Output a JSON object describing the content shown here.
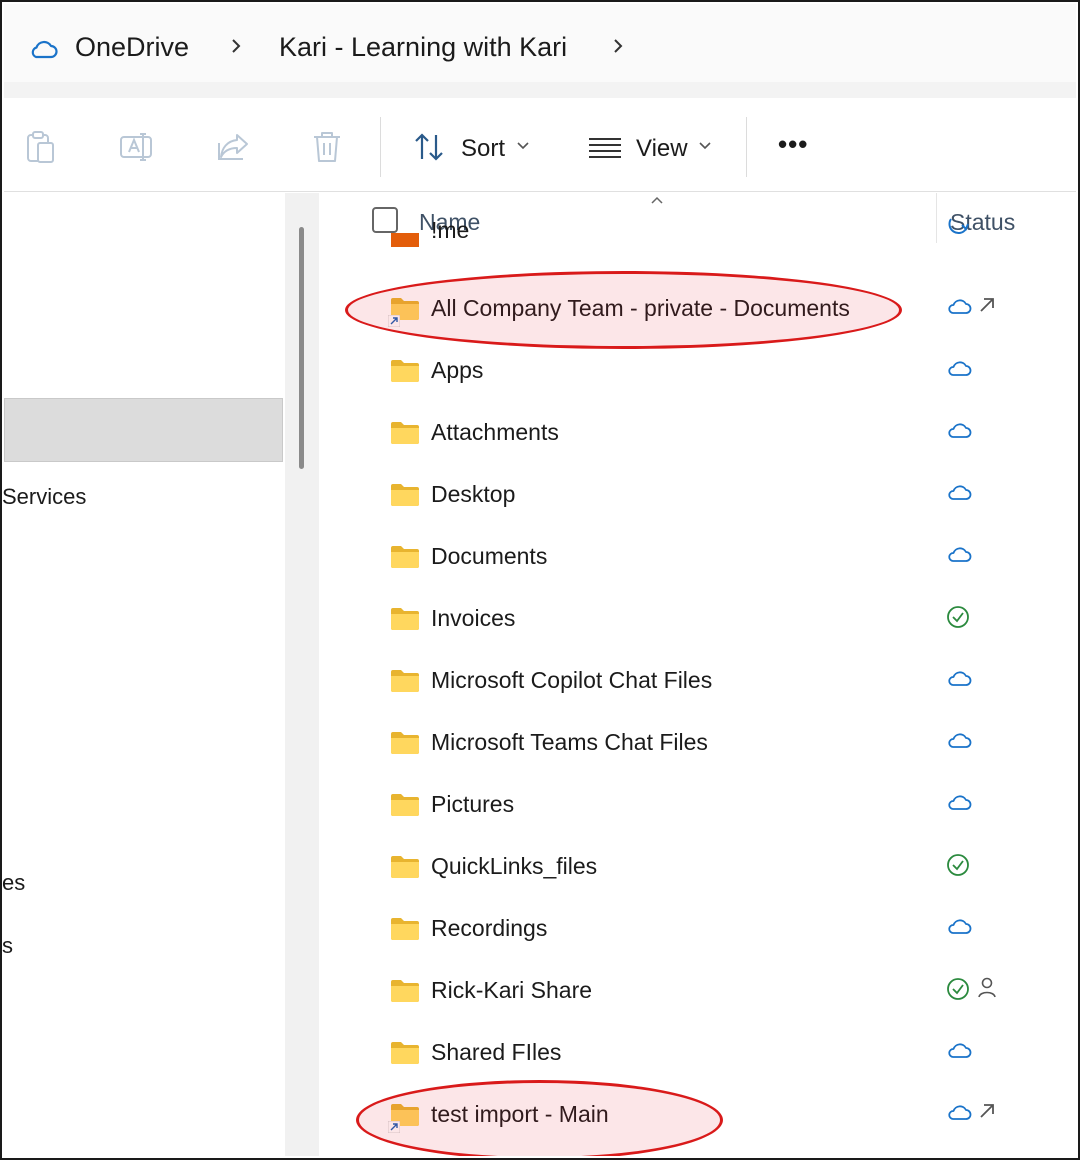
{
  "breadcrumb": {
    "root": "OneDrive",
    "current": "Kari - Learning with Kari"
  },
  "commandbar": {
    "sort_label": "Sort",
    "view_label": "View",
    "more_label": "•••"
  },
  "nav": {
    "items": [
      {
        "label": "Services"
      },
      {
        "label": "es"
      },
      {
        "label": "s"
      }
    ]
  },
  "columns": {
    "name": "Name",
    "status": "Status"
  },
  "files": [
    {
      "name": "!me",
      "status": "syncing",
      "extra": ""
    },
    {
      "name": "All Company Team - private - Documents",
      "status": "cloud",
      "extra": "shortcut"
    },
    {
      "name": "Apps",
      "status": "cloud",
      "extra": ""
    },
    {
      "name": "Attachments",
      "status": "cloud",
      "extra": ""
    },
    {
      "name": "Desktop",
      "status": "cloud",
      "extra": ""
    },
    {
      "name": "Documents",
      "status": "cloud",
      "extra": ""
    },
    {
      "name": "Invoices",
      "status": "available",
      "extra": ""
    },
    {
      "name": "Microsoft Copilot Chat Files",
      "status": "cloud",
      "extra": ""
    },
    {
      "name": "Microsoft Teams Chat Files",
      "status": "cloud",
      "extra": ""
    },
    {
      "name": "Pictures",
      "status": "cloud",
      "extra": ""
    },
    {
      "name": "QuickLinks_files",
      "status": "available",
      "extra": ""
    },
    {
      "name": "Recordings",
      "status": "cloud",
      "extra": ""
    },
    {
      "name": "Rick-Kari Share",
      "status": "available",
      "extra": "shared"
    },
    {
      "name": "Shared FIles",
      "status": "cloud",
      "extra": ""
    },
    {
      "name": "test import - Main",
      "status": "cloud",
      "extra": "shortcut"
    }
  ],
  "colors": {
    "cloud_blue": "#1a73c9",
    "check_green": "#2b8a3e",
    "highlight_red": "#d91a1a",
    "folder_yellow": "#f7c948"
  }
}
